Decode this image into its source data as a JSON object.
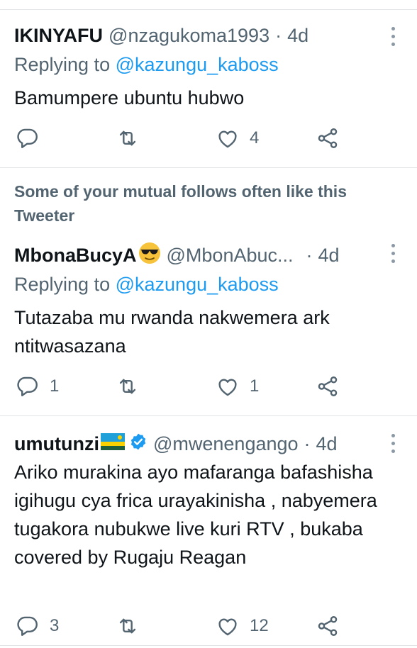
{
  "tweets": [
    {
      "name": "IKINYAFU",
      "name_emoji": "",
      "handle": "@nzagukoma1993",
      "time": "4d",
      "replying_prefix": "Replying to",
      "replying_to": "@kazungu_kaboss",
      "text": "Bamumpere ubuntu hubwo",
      "reply_count": "",
      "retweet_count": "",
      "like_count": "4"
    },
    {
      "name": "MbonaBucyA",
      "name_emoji": "smiling-face-with-sunglasses",
      "handle": "@MbonAbuc...",
      "time": "4d",
      "replying_prefix": "Replying to",
      "replying_to": "@kazungu_kaboss",
      "text": "Tutazaba mu rwanda nakwemera ark ntitwasazana",
      "reply_count": "1",
      "retweet_count": "",
      "like_count": "1"
    },
    {
      "name": "umutunzi",
      "name_emoji": "rwanda-flag",
      "verified": true,
      "handle": "@mwenengango",
      "time": "4d",
      "text": "Ariko murakina ayo mafaranga bafashisha igihugu cya frica urayakinisha , nabyemera tugakora nubukwe live kuri RTV , bukaba covered by Rugaju Reagan",
      "reply_count": "3",
      "retweet_count": "",
      "like_count": "12"
    }
  ],
  "suggestion": {
    "text": "Some of your mutual follows often like this Tweeter"
  },
  "icons": {
    "reply": "reply-icon",
    "retweet": "retweet-icon",
    "like": "heart-icon",
    "share": "share-icon",
    "more": "more-icon",
    "verified": "verified-badge-icon"
  },
  "colors": {
    "link": "#1d9bf0",
    "secondary_text": "#536471",
    "primary_text": "#0f1419",
    "divider": "#e1e5e8"
  }
}
